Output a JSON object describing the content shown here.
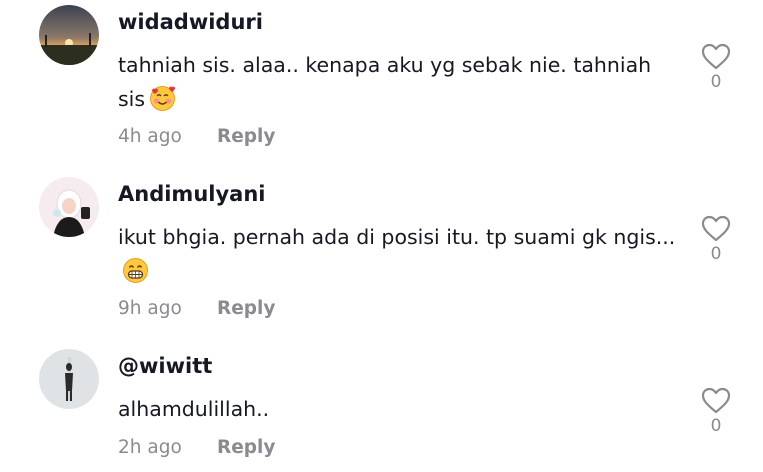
{
  "comments": [
    {
      "username": "widadwiduri",
      "text": "tahniah sis. alaa.. kenapa aku yg sebak nie. tahniah sis",
      "emoji": "smiling-face-with-hearts",
      "time": "4h ago",
      "reply_label": "Reply",
      "likes": "0",
      "avatar": "sunset-photo"
    },
    {
      "username": "Andimulyani",
      "text": "ikut bhgia. pernah ada di posisi itu. tp suami gk ngis...",
      "emoji": "grinning-face",
      "time": "9h ago",
      "reply_label": "Reply",
      "likes": "0",
      "avatar": "cartoon-hijab-girl"
    },
    {
      "username": "@wiwitt",
      "text": "alhamdulillah..",
      "emoji": "",
      "time": "2h ago",
      "reply_label": "Reply",
      "likes": "0",
      "avatar": "standing-figure"
    }
  ],
  "colors": {
    "text": "#161823",
    "muted": "#8a8b91",
    "heart_outline": "#8a8b91"
  }
}
